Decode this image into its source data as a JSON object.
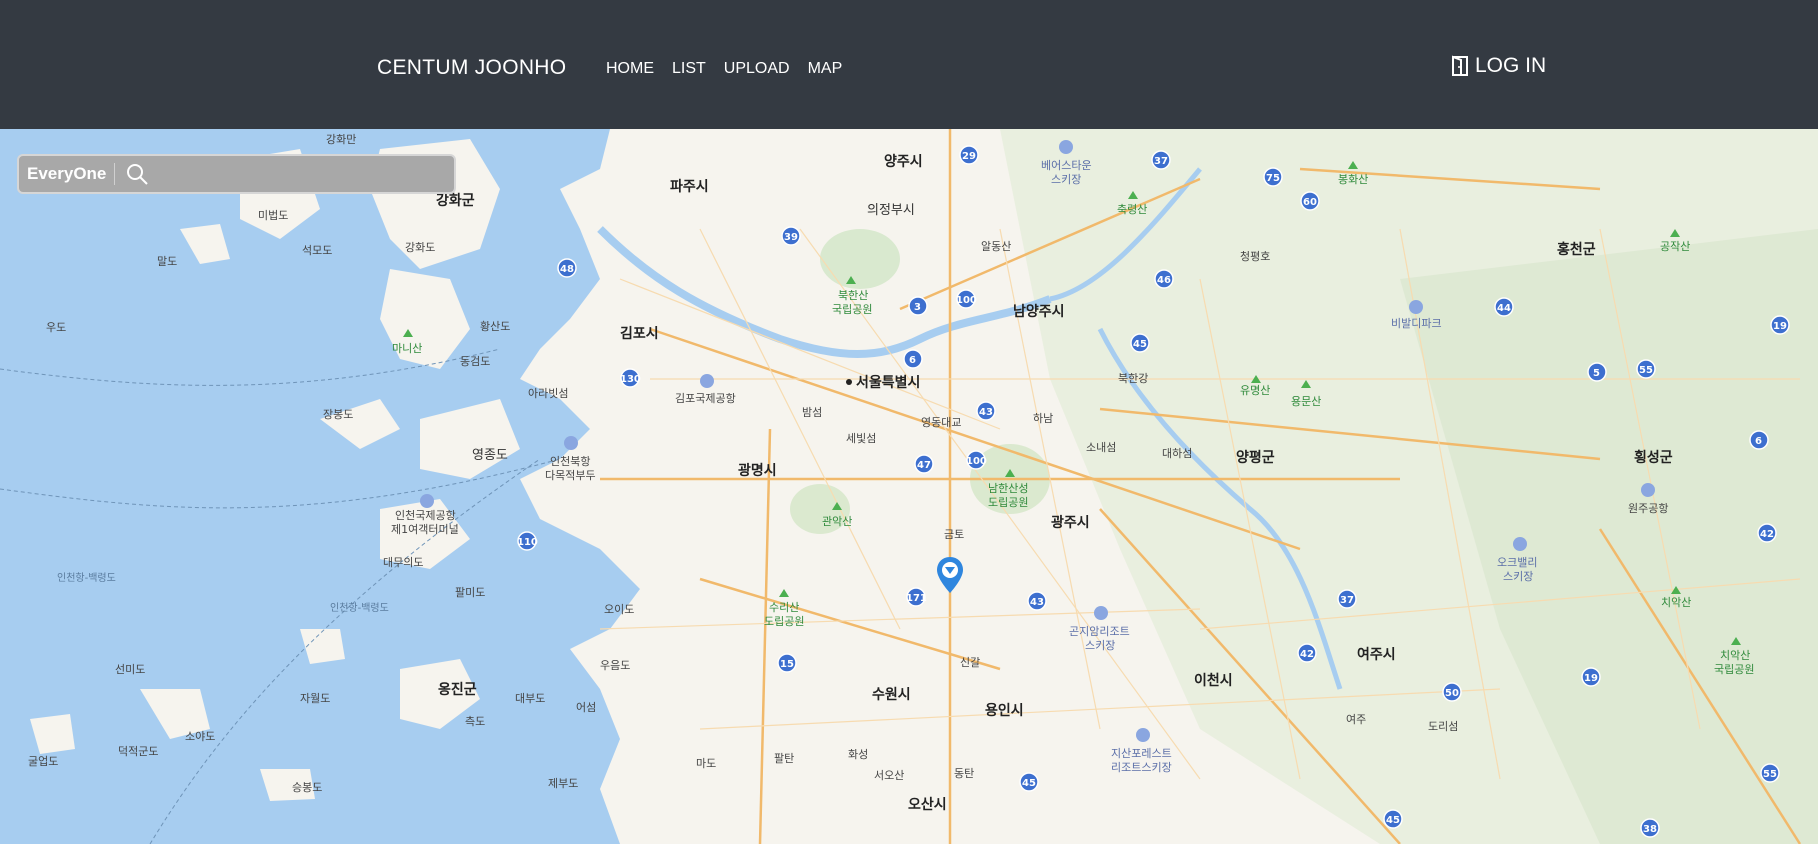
{
  "header": {
    "brand": "CENTUM JOONHO",
    "nav": [
      "HOME",
      "LIST",
      "UPLOAD",
      "MAP"
    ],
    "login_label": "LOG IN"
  },
  "search": {
    "filter_label": "EveryOne",
    "placeholder": "",
    "icon": "search-icon"
  },
  "map": {
    "labels": {
      "seoul": "서울특별시",
      "paju": "파주시",
      "yangju": "양주시",
      "uijeongbu": "의정부시",
      "gimpo": "김포시",
      "ganghwa": "강화군",
      "ganghwado": "강화도",
      "namyangju": "남양주시",
      "gwangmyeong": "광명시",
      "gwangju": "광주시",
      "suwon": "수원시",
      "yongin": "용인시",
      "osan": "오산시",
      "icheon": "이천시",
      "yeoju": "여주시",
      "yangpyeong": "양평군",
      "hongcheon": "홍천군",
      "hoengseong": "횡성군",
      "ongjin": "옹진군",
      "yeongjongdo": "영종도",
      "incheon_airport": "인천국제공항",
      "incheon_terminal": "제1여객터미널",
      "gimpo_airport": "김포국제공항",
      "bukhansan": "북한산",
      "bukhansan_park": "국립공원",
      "gwanaksan": "관악산",
      "suri": "수리산",
      "suri_park": "도립공원",
      "namhansan": "남한산성",
      "namhansan_park": "도립공원",
      "yongmunsan": "용문산",
      "yumyeongsan": "유명산",
      "chiaksan": "치악산",
      "chiaksan2": "치악산",
      "chiaksan_park": "국립공원",
      "gongjaksan": "공작산",
      "bonghwasan": "봉화산",
      "chungnyeongsan": "축령산",
      "manisan": "마니산",
      "bearstown": "베어스타운",
      "bearstown_ski": "스키장",
      "gonjiam": "곤지암리조트",
      "gonjiam_ski": "스키장",
      "jisan": "지산포레스트",
      "jisan_ski": "리조트스키장",
      "oakvalley": "오크밸리",
      "oakvalley_ski": "스키장",
      "vivaldi": "비발디파크",
      "wonju_airport": "원주공항",
      "dasibul": "인천북항",
      "dasibul2": "다목적부두",
      "ara": "아라빗섬",
      "hanam": "하남",
      "bundang": "소내섬",
      "daeha": "대하섬",
      "sejeong": "세빛섬",
      "bamseom": "밤섬",
      "yeongdong": "영동대교",
      "geumto": "금토",
      "sinchon": "신갈",
      "dongtan": "동탄",
      "hwaseong": "화성",
      "ansan_seo": "서오산",
      "palmido": "팔미도",
      "daemuuido": "대무의도",
      "seonmido": "선미도",
      "jawoldo": "자월도",
      "daebudo": "대부도",
      "eoseom": "어섬",
      "oido": "오이도",
      "ueumdo": "우음도",
      "jeokdo": "측도",
      "sayado": "소야도",
      "deokjeokdo": "덕적군도",
      "gureopdo": "굴업도",
      "seungbongdo": "승봉도",
      "jebudo": "제부도",
      "madomado": "마도",
      "palltan": "팔탄",
      "mibeopdo": "미법도",
      "seokmodo": "석모도",
      "maldo": "말도",
      "udo": "우도",
      "hwangsando": "황산도",
      "donggeomdo": "동검도",
      "jangbongdo": "장봉도",
      "ganghwaman": "강화만",
      "cheongpyeong": "청평호",
      "bukhangang": "북한강",
      "seaway1": "인천항-백령도",
      "seaway2": "인천항-백령도",
      "toi": "도리섬",
      "almdong": "알동산",
      "munchi": "여주"
    },
    "marker": "map-pin-icon"
  }
}
